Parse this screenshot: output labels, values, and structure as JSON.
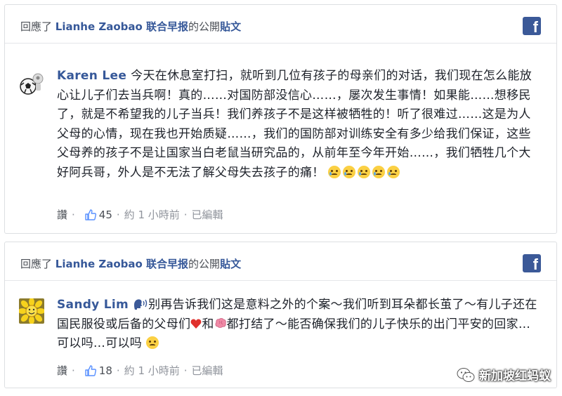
{
  "posts": [
    {
      "header": {
        "prefix": "回應了 ",
        "page_name": "Lianhe Zaobao 联合早报",
        "middle": "的公開",
        "post_word": "貼文"
      },
      "comment": {
        "author": "Karen Lee",
        "text": "今天在休息室打扫，就听到几位有孩子的母亲们的对话，我们现在怎么能放心让儿子们去当兵啊！真的……对国防部没信心……，屡次发生事情！如果能……想移民了，就是不希望我的儿子当兵！我们养孩子不是这样被牺牲的！听了很难过……这是为人父母的心情，现在我也开始质疑……，我们的国防部对训练安全有多少给我们保证，这些父母养的孩子不是让国家当白老鼠当研究品的，从前年至今年开始……，我们牺牲几个大好阿兵哥，外人是不无法了解父母失去孩子的痛！",
        "emoji": [
          "crying-face-emoji",
          "crying-face-emoji",
          "crying-face-emoji",
          "crying-face-emoji",
          "crying-face-emoji"
        ]
      },
      "meta": {
        "like_label": "讚",
        "like_count": "45",
        "time": "約 1 小時前",
        "edited": "已編輯"
      }
    },
    {
      "header": {
        "prefix": "回應了 ",
        "page_name": "Lianhe Zaobao 联合早报",
        "middle": "的公開",
        "post_word": "貼文"
      },
      "comment": {
        "author": "Sandy Lim",
        "text_part1": "别再告诉我们这是意料之外的个案～我们听到耳朵都长茧了～有儿子还在国民服役或后备的父母们",
        "text_part2": "和",
        "text_part3": "都打结了～能否确保我们的儿子快乐的出门平安的回家…可以吗…可以吗"
      },
      "meta": {
        "like_label": "讚",
        "like_count": "18",
        "time": "約 1 小時前",
        "edited": "已編輯"
      }
    }
  ],
  "watermark": "新加坡红蚂蚁",
  "colors": {
    "link": "#365899",
    "facebook": "#3b5998",
    "meta_text": "#90949c"
  }
}
